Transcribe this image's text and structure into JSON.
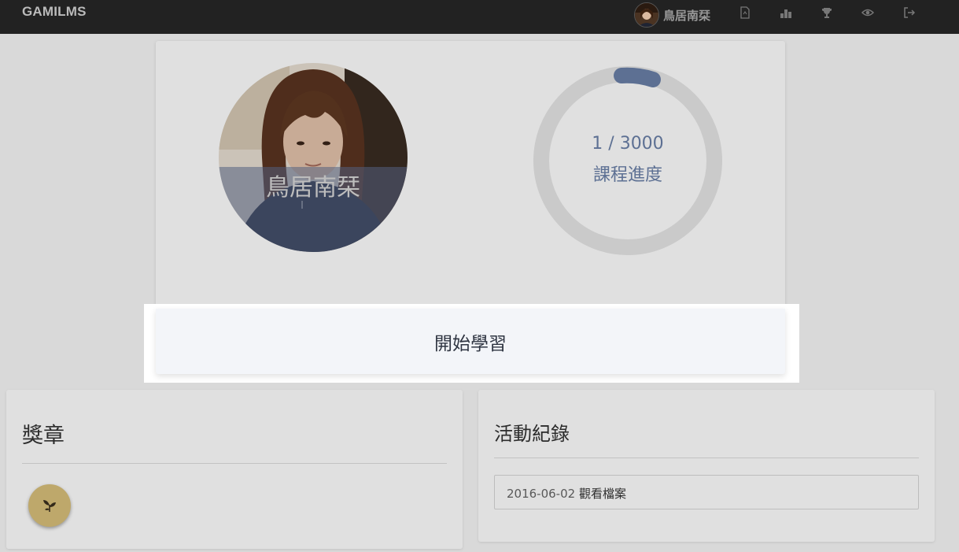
{
  "navbar": {
    "brand": "GAMILMS",
    "username": "鳥居南栞",
    "icons": [
      "document-icon",
      "leaderboard-icon",
      "trophy-icon",
      "eye-icon",
      "logout-icon"
    ]
  },
  "profile": {
    "name": "鳥居南栞",
    "progress_text": "1 / 3000",
    "progress_label": "課程進度",
    "progress_fraction": 0.000333
  },
  "start_button_label": "開始學習",
  "badges": {
    "title": "獎章",
    "items": [
      {
        "icon": "sprout-badge-icon",
        "color": "#d9c07a"
      }
    ]
  },
  "activity": {
    "title": "活動紀錄",
    "items": [
      {
        "date": "2016-06-02",
        "text": "觀看檔案"
      }
    ]
  },
  "colors": {
    "navbar_bg": "#222222",
    "progress_accent": "#6a80a8",
    "ring_track": "#e6e6e6"
  }
}
